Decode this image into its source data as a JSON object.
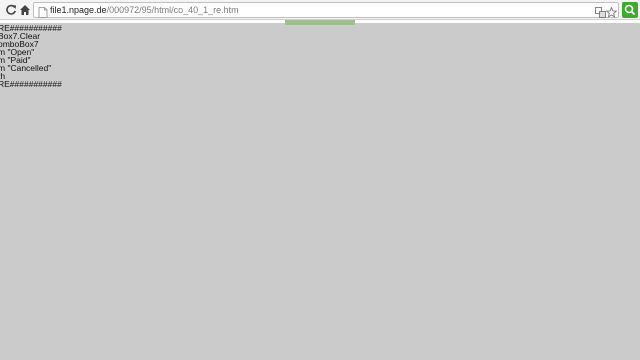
{
  "browser": {
    "url_host": "file1.npage.de",
    "url_path": "/000972/95/html/co_40_1_re.htm",
    "icons": [
      "reload-icon",
      "home-icon",
      "page-icon",
      "translate-icon",
      "star-icon",
      "extension-icon"
    ],
    "accent_color": "#3faa2f"
  },
  "page": {
    "lines": [
      "RE###########",
      "Box7.Clear",
      "omboBox7",
      "m \"Open\"",
      "m \"Paid\"",
      "m \"Cancelled\"",
      "th",
      "RE###########"
    ]
  }
}
